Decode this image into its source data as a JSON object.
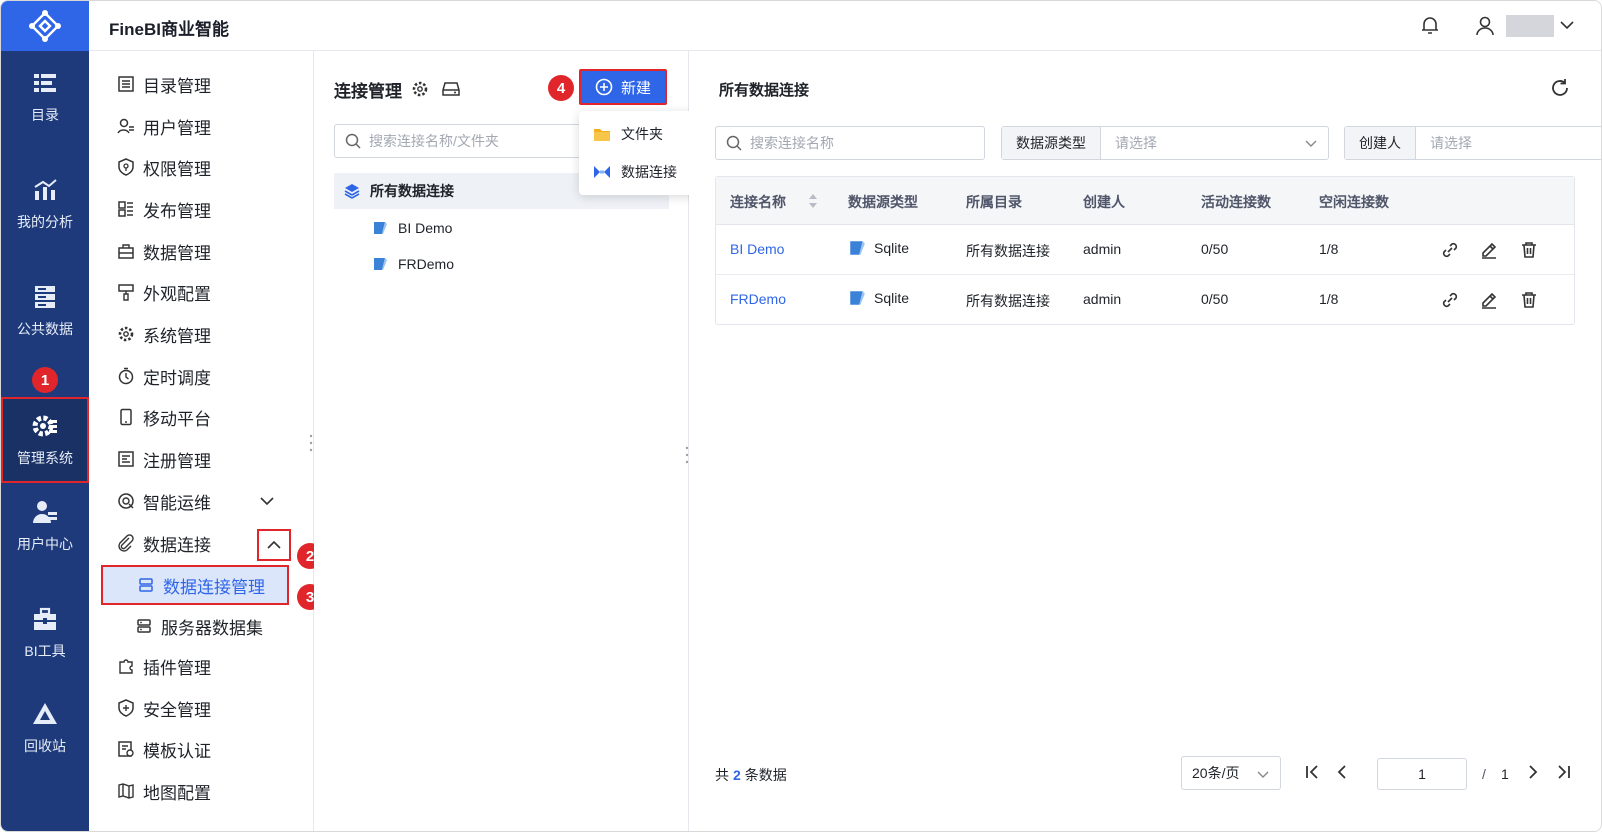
{
  "header": {
    "app_title": "FineBI商业智能"
  },
  "leftnav": {
    "items": [
      {
        "label": "目录",
        "icon": "catalog-icon"
      },
      {
        "label": "我的分析",
        "icon": "analysis-icon"
      },
      {
        "label": "公共数据",
        "icon": "public-data-icon"
      },
      {
        "label": "管理系统",
        "icon": "management-icon",
        "active": true
      },
      {
        "label": "用户中心",
        "icon": "user-center-icon"
      },
      {
        "label": "BI工具",
        "icon": "bi-tools-icon"
      },
      {
        "label": "回收站",
        "icon": "recycle-bin-icon"
      }
    ]
  },
  "menu": {
    "items": [
      {
        "label": "目录管理"
      },
      {
        "label": "用户管理"
      },
      {
        "label": "权限管理"
      },
      {
        "label": "发布管理"
      },
      {
        "label": "数据管理"
      },
      {
        "label": "外观配置"
      },
      {
        "label": "系统管理"
      },
      {
        "label": "定时调度"
      },
      {
        "label": "移动平台"
      },
      {
        "label": "注册管理"
      },
      {
        "label": "智能运维"
      },
      {
        "label": "数据连接"
      },
      {
        "label": "插件管理"
      },
      {
        "label": "安全管理"
      },
      {
        "label": "模板认证"
      },
      {
        "label": "地图配置"
      }
    ],
    "sub_items": [
      {
        "label": "数据连接管理",
        "active": true
      },
      {
        "label": "服务器数据集"
      }
    ]
  },
  "badges": [
    "1",
    "2",
    "3",
    "4"
  ],
  "middle": {
    "title": "连接管理",
    "new_button": "新建",
    "search_placeholder": "搜索连接名称/文件夹",
    "tree_root": "所有数据连接",
    "tree_items": [
      "BI Demo",
      "FRDemo"
    ]
  },
  "popup": {
    "items": [
      {
        "label": "文件夹",
        "icon": "folder-icon"
      },
      {
        "label": "数据连接",
        "icon": "data-connection-icon"
      }
    ]
  },
  "content": {
    "title": "所有数据连接",
    "search_placeholder": "搜索连接名称",
    "filters": [
      {
        "label": "数据源类型",
        "placeholder": "请选择"
      },
      {
        "label": "创建人",
        "placeholder": "请选择"
      }
    ],
    "columns": [
      "连接名称",
      "数据源类型",
      "所属目录",
      "创建人",
      "活动连接数",
      "空闲连接数"
    ],
    "rows": [
      {
        "name": "BI Demo",
        "type": "Sqlite",
        "dir": "所有数据连接",
        "creator": "admin",
        "active": "0/50",
        "idle": "1/8"
      },
      {
        "name": "FRDemo",
        "type": "Sqlite",
        "dir": "所有数据连接",
        "creator": "admin",
        "active": "0/50",
        "idle": "1/8"
      }
    ],
    "footer": {
      "prefix": "共",
      "count": "2",
      "suffix": "条数据",
      "page_size": "20条/页",
      "current_page": "1",
      "total_pages": "1",
      "slash": "/"
    }
  },
  "colors": {
    "accent": "#2f66e8",
    "nav_bg": "#1e3a7b",
    "highlight": "#e0262b"
  }
}
